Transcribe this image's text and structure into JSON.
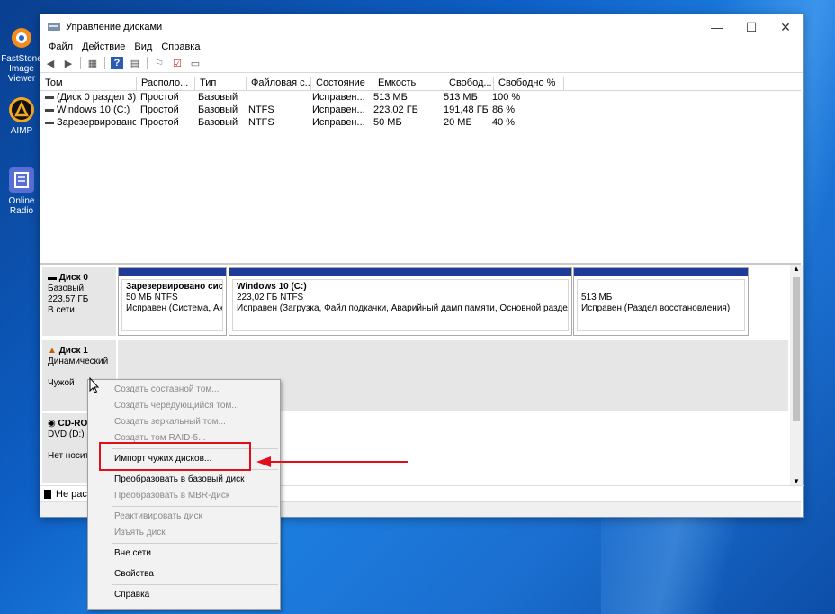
{
  "desktop": {
    "icons": [
      {
        "label": "FastStone Image Viewer",
        "icon": "faststone-icon"
      },
      {
        "label": "AIMP",
        "icon": "aimp-icon"
      },
      {
        "label": "Online Radio",
        "icon": "radio-icon"
      }
    ]
  },
  "window": {
    "title": "Управление дисками",
    "controls": {
      "minimize": "—",
      "maximize": "☐",
      "close": "✕"
    }
  },
  "menu": [
    "Файл",
    "Действие",
    "Вид",
    "Справка"
  ],
  "volumes": {
    "columns": [
      "Том",
      "Располо...",
      "Тип",
      "Файловая с...",
      "Состояние",
      "Емкость",
      "Свобод...",
      "Свободно %"
    ],
    "rows": [
      [
        "(Диск 0 раздел 3)",
        "Простой",
        "Базовый",
        "",
        "Исправен...",
        "513 МБ",
        "513 МБ",
        "100 %"
      ],
      [
        "Windows 10 (C:)",
        "Простой",
        "Базовый",
        "NTFS",
        "Исправен...",
        "223,02 ГБ",
        "191,48 ГБ",
        "86 %"
      ],
      [
        "Зарезервировано...",
        "Простой",
        "Базовый",
        "NTFS",
        "Исправен...",
        "50 МБ",
        "20 МБ",
        "40 %"
      ]
    ]
  },
  "disks": {
    "disk0": {
      "name": "Диск 0",
      "type": "Базовый",
      "size": "223,57 ГБ",
      "status": "В сети",
      "partitions": [
        {
          "title": "Зарезервировано систе",
          "size": "50 МБ NTFS",
          "status": "Исправен (Система, Акт"
        },
        {
          "title": "Windows 10  (C:)",
          "size": "223,02 ГБ NTFS",
          "status": "Исправен (Загрузка, Файл подкачки, Аварийный дамп памяти, Основной раздел)"
        },
        {
          "title": "",
          "size": "513 МБ",
          "status": "Исправен (Раздел восстановления)"
        }
      ]
    },
    "disk1": {
      "name": "Диск 1",
      "type": "Динамический",
      "status": "Чужой"
    },
    "cdrom": {
      "name": "CD-RO",
      "drive": "DVD (D:)",
      "status": "Нет носит"
    }
  },
  "legend": {
    "label": "Не расп"
  },
  "context_menu": {
    "groups": [
      [
        {
          "label": "Создать составной том...",
          "enabled": false
        },
        {
          "label": "Создать чередующийся том...",
          "enabled": false
        },
        {
          "label": "Создать зеркальный том...",
          "enabled": false
        },
        {
          "label": "Создать том RAID-5...",
          "enabled": false
        }
      ],
      [
        {
          "label": "Импорт чужих дисков...",
          "enabled": true
        }
      ],
      [
        {
          "label": "Преобразовать в базовый диск",
          "enabled": true
        },
        {
          "label": "Преобразовать в MBR-диск",
          "enabled": false
        }
      ],
      [
        {
          "label": "Реактивировать диск",
          "enabled": false
        },
        {
          "label": "Изъять диск",
          "enabled": false
        }
      ],
      [
        {
          "label": "Вне сети",
          "enabled": true
        }
      ],
      [
        {
          "label": "Свойства",
          "enabled": true
        }
      ],
      [
        {
          "label": "Справка",
          "enabled": true
        }
      ]
    ]
  },
  "annotation": {
    "color": "#e0101a"
  }
}
